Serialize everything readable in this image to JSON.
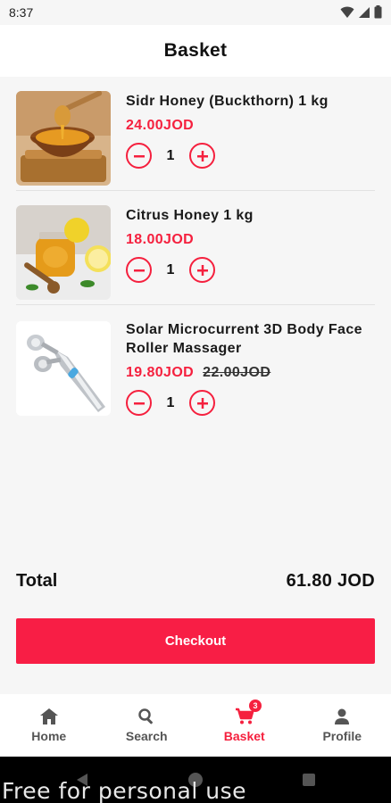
{
  "status_bar": {
    "time": "8:37"
  },
  "header": {
    "title": "Basket"
  },
  "cart": {
    "items": [
      {
        "name": "Sidr Honey (Buckthorn) 1 kg",
        "price": "24.00JOD",
        "quantity": "1",
        "image": "honey-bowl-image"
      },
      {
        "name": "Citrus Honey 1 kg",
        "price": "18.00JOD",
        "quantity": "1",
        "image": "citrus-honey-jar-image"
      },
      {
        "name": "Solar Microcurrent 3D Body Face Roller Massager",
        "price": "19.80JOD",
        "old_price": "22.00JOD",
        "quantity": "1",
        "image": "face-roller-image"
      }
    ]
  },
  "summary": {
    "total_label": "Total",
    "total_value": "61.80 JOD"
  },
  "checkout": {
    "label": "Checkout"
  },
  "bottom_nav": {
    "items": [
      {
        "label": "Home",
        "icon": "home-icon"
      },
      {
        "label": "Search",
        "icon": "search-icon"
      },
      {
        "label": "Basket",
        "icon": "cart-icon",
        "badge": "3",
        "active": true
      },
      {
        "label": "Profile",
        "icon": "person-icon"
      }
    ]
  },
  "watermark": "Free for personal use",
  "colors": {
    "accent": "#f5203e",
    "checkout": "#f81e45",
    "background": "#f6f6f6"
  }
}
